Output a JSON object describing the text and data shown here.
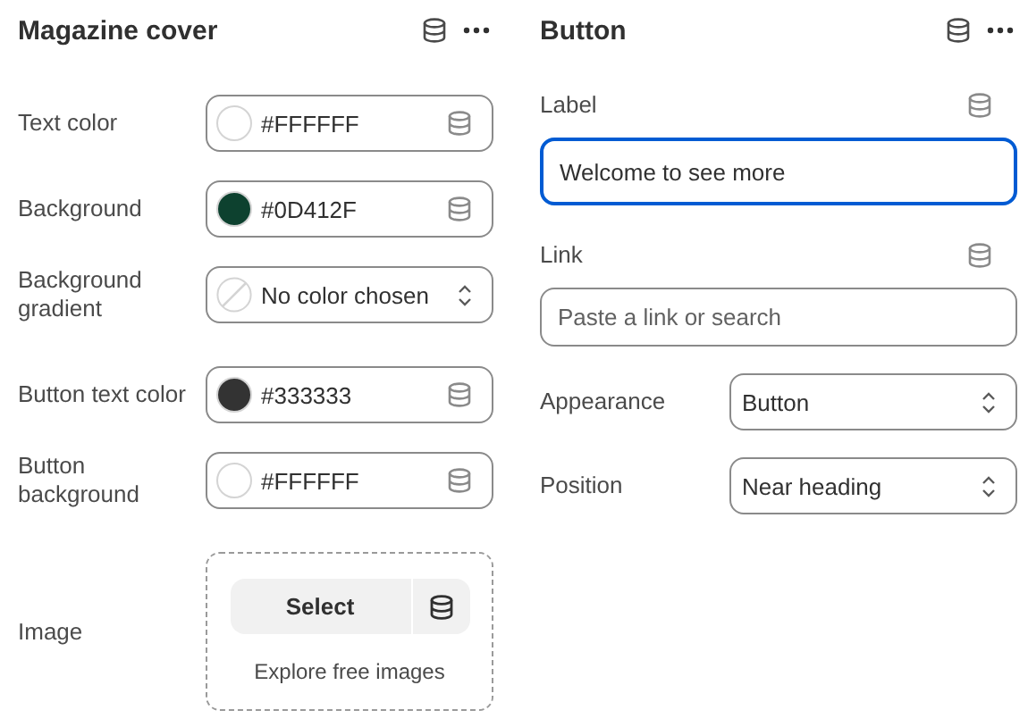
{
  "left": {
    "title": "Magazine cover",
    "rows": [
      {
        "kind": "color",
        "label": "Text color",
        "value": "#FFFFFF",
        "color": "#ffffff"
      },
      {
        "kind": "color",
        "label": "Background",
        "value": "#0D412F",
        "color": "#0d412f"
      },
      {
        "kind": "no-color",
        "label": "Background gradient",
        "value": "No color chosen"
      },
      {
        "kind": "color",
        "label": "Button text color",
        "value": "#333333",
        "color": "#333333"
      },
      {
        "kind": "color",
        "label": "Button background",
        "value": "#FFFFFF",
        "color": "#ffffff"
      },
      {
        "kind": "image",
        "label": "Image",
        "button": "Select",
        "hint": "Explore free images"
      }
    ]
  },
  "right": {
    "title": "Button",
    "fields": [
      {
        "kind": "text",
        "label": "Label",
        "value": "Welcome to see more",
        "focused": true
      },
      {
        "kind": "text",
        "label": "Link",
        "placeholder": "Paste a link or search",
        "focused": false
      },
      {
        "kind": "select",
        "label": "Appearance",
        "value": "Button"
      },
      {
        "kind": "select",
        "label": "Position",
        "value": "Near heading"
      }
    ]
  }
}
